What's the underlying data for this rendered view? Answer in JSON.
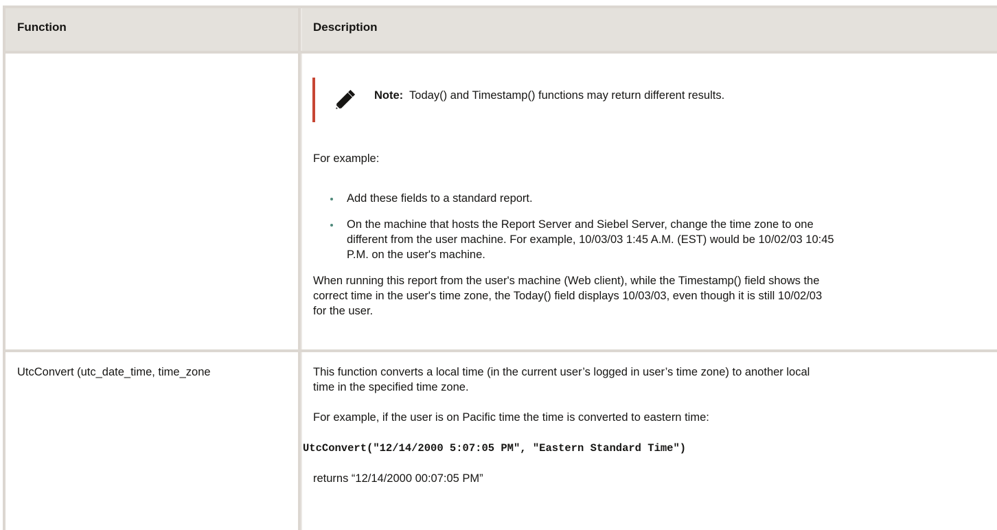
{
  "table": {
    "headers": {
      "function": "Function",
      "description": "Description"
    }
  },
  "row1": {
    "note_label": "Note:",
    "note_text": "Today() and Timestamp() functions may return different results.",
    "for_example": "For example:",
    "bullets": [
      "Add these fields to a standard report.",
      "On the machine that hosts the Report Server and Siebel Server, change the time zone to one",
      "different from the user machine. For example, 10/03/03 1:45 A.M. (EST) would be 10/02/03 10:45",
      "P.M. on the user's machine."
    ],
    "para_lines": [
      "When running this report from the user's machine (Web client), while the Timestamp() field shows the",
      "correct time in the user's time zone, the Today() field displays 10/03/03, even though it is still 10/02/03",
      "for the user."
    ]
  },
  "row2": {
    "function": "UtcConvert (utc_date_time, time_zone",
    "desc_lines": [
      "This function converts a local time (in the current user’s logged in user’s time zone) to another local",
      "time in the specified time zone."
    ],
    "example": "For example, if the user is on Pacific time the time is converted to eastern time:",
    "code": "UtcConvert(\"12/14/2000 5:07:05 PM\", \"Eastern Standard Time\")",
    "returns": "returns “12/14/2000 00:07:05 PM”"
  }
}
